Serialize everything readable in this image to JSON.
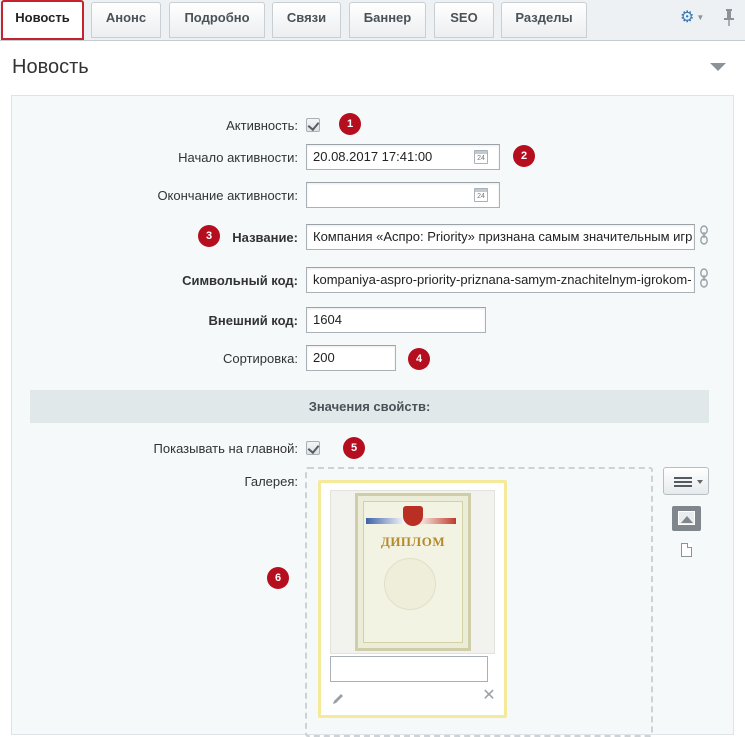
{
  "tabs": [
    {
      "label": "Новость",
      "active": true
    },
    {
      "label": "Анонс"
    },
    {
      "label": "Подробно"
    },
    {
      "label": "Связи"
    },
    {
      "label": "Баннер"
    },
    {
      "label": "SEO"
    },
    {
      "label": "Разделы"
    }
  ],
  "toolbar": {
    "settings_icon": "gear-icon",
    "pin_icon": "pin-icon"
  },
  "section": {
    "title": "Новость"
  },
  "fields": {
    "active": {
      "label": "Активность:",
      "checked": true,
      "marker": "1"
    },
    "start": {
      "label": "Начало активности:",
      "value": "20.08.2017 17:41:00",
      "marker": "2",
      "cal_day": "24"
    },
    "end": {
      "label": "Окончание активности:",
      "value": "",
      "cal_day": "24"
    },
    "name": {
      "label": "Название:",
      "value": "Компания «Аспро: Priority» признана самым значительным игр",
      "marker": "3"
    },
    "code": {
      "label": "Символьный код:",
      "value": "kompaniya-aspro-priority-priznana-samym-znachitelnym-igrokom-"
    },
    "external": {
      "label": "Внешний код:",
      "value": "1604"
    },
    "sort": {
      "label": "Сортировка:",
      "value": "200",
      "marker": "4"
    }
  },
  "properties": {
    "header": "Значения свойств:",
    "show_main": {
      "label": "Показывать на главной:",
      "checked": true,
      "marker": "5"
    },
    "gallery": {
      "label": "Галерея:",
      "marker": "6",
      "image_title": "ДИПЛОМ",
      "caption_value": ""
    }
  },
  "colors": {
    "accent": "#c4242e",
    "marker": "#b50f1f",
    "panel_bg": "#f5f9f9"
  }
}
